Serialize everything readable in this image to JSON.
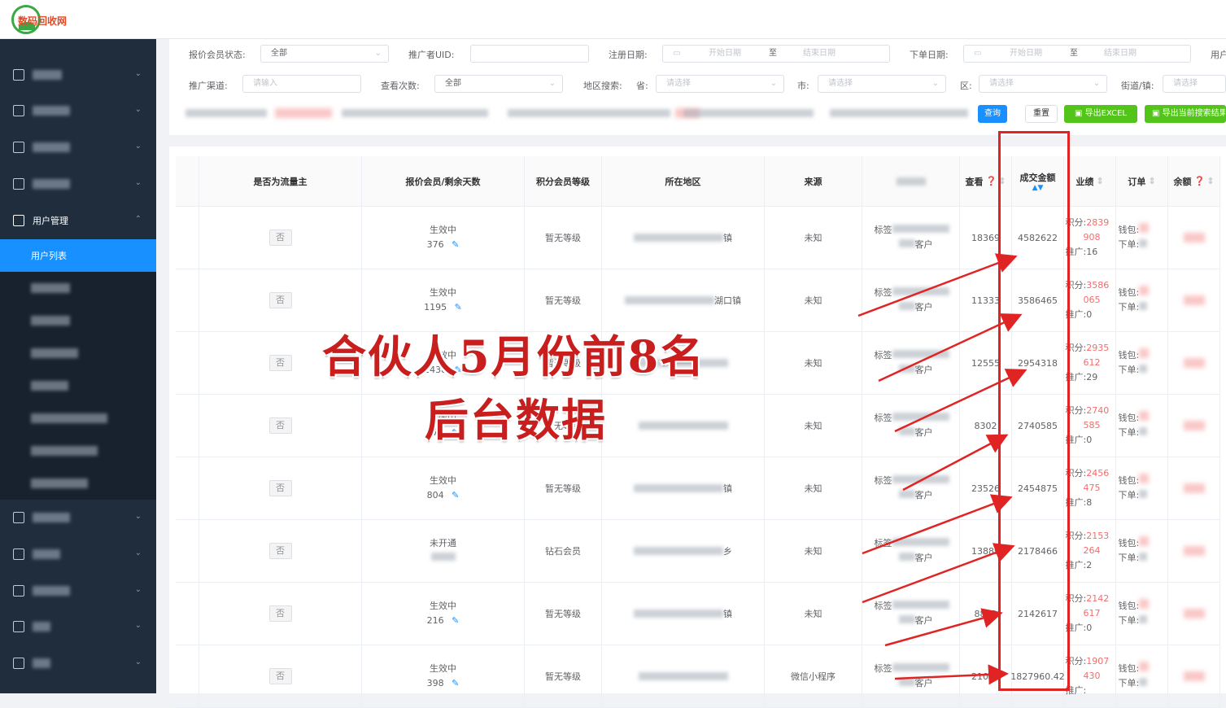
{
  "app": {
    "logo_text": "数码回收网"
  },
  "sidebar": {
    "open_group_label": "用户管理",
    "active_item_label": "用户列表"
  },
  "filters": {
    "member_status_label": "报价会员状态:",
    "member_status_value": "全部",
    "promoter_uid_label": "推广者UID:",
    "promoter_uid_value": "",
    "reg_date_label": "注册日期:",
    "order_date_label": "下单日期:",
    "start_date_placeholder": "开始日期",
    "end_date_placeholder": "结束日期",
    "date_to": "至",
    "truncated_label": "用户",
    "channel_label": "推广渠道:",
    "channel_placeholder": "请输入",
    "views_label": "查看次数:",
    "views_value": "全部",
    "region_label": "地区搜索:",
    "province_label": "省:",
    "city_label": "市:",
    "district_label": "区:",
    "street_label": "街道/镇:",
    "select_placeholder": "请选择"
  },
  "buttons": {
    "search": "查询",
    "reset": "重置",
    "export_excel": "导出EXCEL",
    "export_current": "导出当前搜索结果"
  },
  "table": {
    "headers": {
      "is_traffic_owner": "是否为流量主",
      "quote_member": "报价会员/剩余天数",
      "points_level": "积分会员等级",
      "region": "所在地区",
      "source": "来源",
      "views": "查看",
      "deal_amount": "成交金额",
      "performance": "业绩",
      "orders": "订单",
      "balance": "余额"
    },
    "labels": {
      "points": "积分:",
      "promote": "推广:",
      "wallet": "钱包:",
      "order": "下单:",
      "customer": "客户",
      "tag": "标签"
    },
    "rows": [
      {
        "owner": "否",
        "status": "生效中",
        "days": "376",
        "level": "暂无等级",
        "region_tail": "镇",
        "source": "未知",
        "views": "18369",
        "amount": "4582622",
        "points1": "2839",
        "points2": "908",
        "promote": "16"
      },
      {
        "owner": "否",
        "status": "生效中",
        "days": "1195",
        "level": "暂无等级",
        "region_tail": "湖口镇",
        "source": "未知",
        "views": "11333",
        "amount": "3586465",
        "points1": "3586",
        "points2": "065",
        "promote": "0"
      },
      {
        "owner": "否",
        "status": "生效中",
        "days": "2438",
        "level": "暂无等级",
        "region_tail": "",
        "source": "未知",
        "views": "12555",
        "amount": "2954318",
        "points1": "2935",
        "points2": "612",
        "promote": "29"
      },
      {
        "owner": "否",
        "status": "生效中",
        "days": "277",
        "level": "暂无等级",
        "region_tail": "",
        "source": "未知",
        "views": "8302",
        "amount": "2740585",
        "points1": "2740",
        "points2": "585",
        "promote": "0"
      },
      {
        "owner": "否",
        "status": "生效中",
        "days": "804",
        "level": "暂无等级",
        "region_tail": "镇",
        "source": "未知",
        "views": "23526",
        "amount": "2454875",
        "points1": "2456",
        "points2": "475",
        "promote": "8"
      },
      {
        "owner": "否",
        "status": "未开通",
        "days": "",
        "level": "钻石会员",
        "region_tail": "乡",
        "source": "未知",
        "views": "13889",
        "amount": "2178466",
        "points1": "2153",
        "points2": "264",
        "promote": "2"
      },
      {
        "owner": "否",
        "status": "生效中",
        "days": "216",
        "level": "暂无等级",
        "region_tail": "镇",
        "source": "未知",
        "views": "8872",
        "amount": "2142617",
        "points1": "2142",
        "points2": "617",
        "promote": "0"
      },
      {
        "owner": "否",
        "status": "生效中",
        "days": "398",
        "level": "暂无等级",
        "region_tail": "",
        "source": "微信小程序",
        "views": "21000",
        "amount": "1827960.42",
        "points1": "1907",
        "points2": "430",
        "promote": ""
      }
    ]
  },
  "annotation": {
    "line1": "合伙人5月份前8名",
    "line2": "后台数据",
    "color": "#c81e1e"
  }
}
